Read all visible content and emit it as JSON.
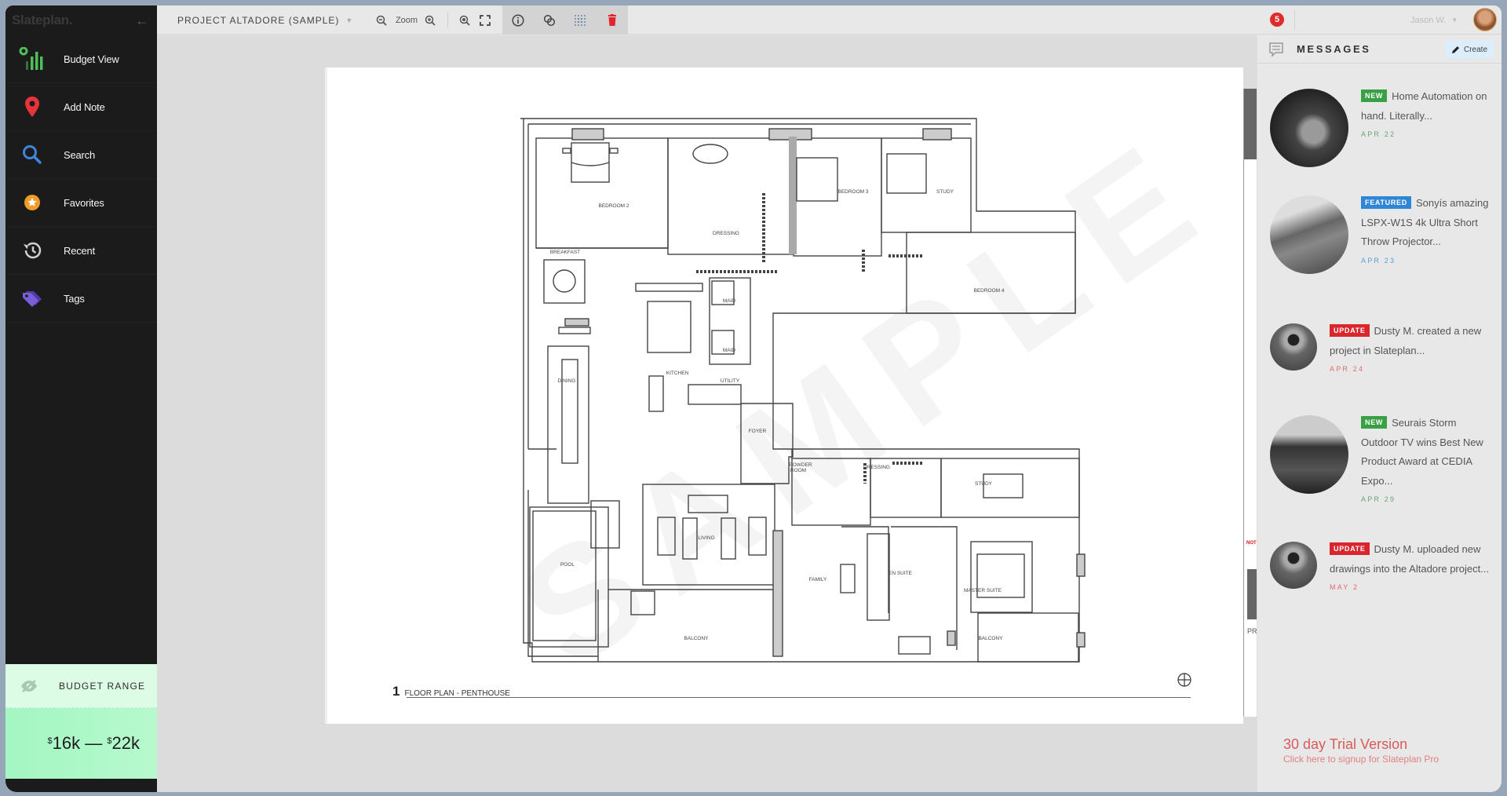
{
  "app": {
    "brand": "Slateplan.",
    "project_title": "PROJECT ALTADORE (SAMPLE)"
  },
  "sidebar": {
    "items": [
      {
        "label": "Budget View",
        "icon": "bar-chart-icon"
      },
      {
        "label": "Add Note",
        "icon": "map-pin-icon"
      },
      {
        "label": "Search",
        "icon": "search-icon"
      },
      {
        "label": "Favorites",
        "icon": "star-icon"
      },
      {
        "label": "Recent",
        "icon": "history-icon"
      },
      {
        "label": "Tags",
        "icon": "tag-icon"
      }
    ],
    "budget": {
      "title": "BUDGET RANGE",
      "currency": "$",
      "low": "16k",
      "separator": "—",
      "high": "22k"
    }
  },
  "toolbar": {
    "zoom_label": "Zoom",
    "tools": [
      "zoom-out",
      "zoom-in",
      "zoom-fit",
      "fullscreen",
      "info",
      "layers",
      "grid",
      "delete"
    ]
  },
  "user": {
    "name": "Jason W.",
    "notification_count": "5"
  },
  "sheet": {
    "watermark": "SAMPLE",
    "drawing_number": "1",
    "drawing_title": "FLOOR PLAN - PENTHOUSE",
    "rooms": [
      "BEDROOM 2",
      "DRESSING",
      "BEDROOM 3",
      "STUDY",
      "BEDROOM 4",
      "BREAKFAST",
      "MAID",
      "MAID",
      "KITCHEN",
      "UTILITY",
      "DINING",
      "FOYER",
      "POWDER ROOM",
      "DRESSING",
      "STUDY",
      "LIVING",
      "POOL",
      "FAMILY",
      "EN SUITE",
      "MASTER SUITE",
      "BALCONY",
      "BALCONY"
    ],
    "side_sheet": {
      "notes_label": "NOT",
      "title_label": "PR"
    }
  },
  "messages": {
    "title": "MESSAGES",
    "create_label": "Create",
    "items": [
      {
        "badge": "NEW",
        "badge_color": "#3aa046",
        "text": "Home Automation on hand. Literally...",
        "date": "APR 22",
        "date_color": "#6aa56f",
        "thumb": "smartwatch-photo"
      },
      {
        "badge": "FEATURED",
        "badge_color": "#2f86d6",
        "text": "Sonyís amazing LSPX-W1S 4k Ultra Short Throw Projector...",
        "date": "APR 23",
        "date_color": "#5b9bd5",
        "thumb": "projector-room-photo"
      },
      {
        "badge": "UPDATE",
        "badge_color": "#d9262d",
        "text": "Dusty M. created a new project in Slateplan...",
        "date": "APR 24",
        "date_color": "#e06b6b",
        "thumb": "user-avatar-dusty"
      },
      {
        "badge": "NEW",
        "badge_color": "#3aa046",
        "text": "Seurais Storm Outdoor TV wins Best New Product Award at CEDIA Expo...",
        "date": "APR 29",
        "date_color": "#6aa56f",
        "thumb": "outdoor-tv-photo"
      },
      {
        "badge": "UPDATE",
        "badge_color": "#d9262d",
        "text": "Dusty M. uploaded new drawings into the Altadore project...",
        "date": "MAY 2",
        "date_color": "#e06b6b",
        "thumb": "user-avatar-dusty"
      }
    ],
    "trial": {
      "title": "30 day Trial Version",
      "subtitle": "Click here to signup for Slateplan Pro"
    }
  }
}
